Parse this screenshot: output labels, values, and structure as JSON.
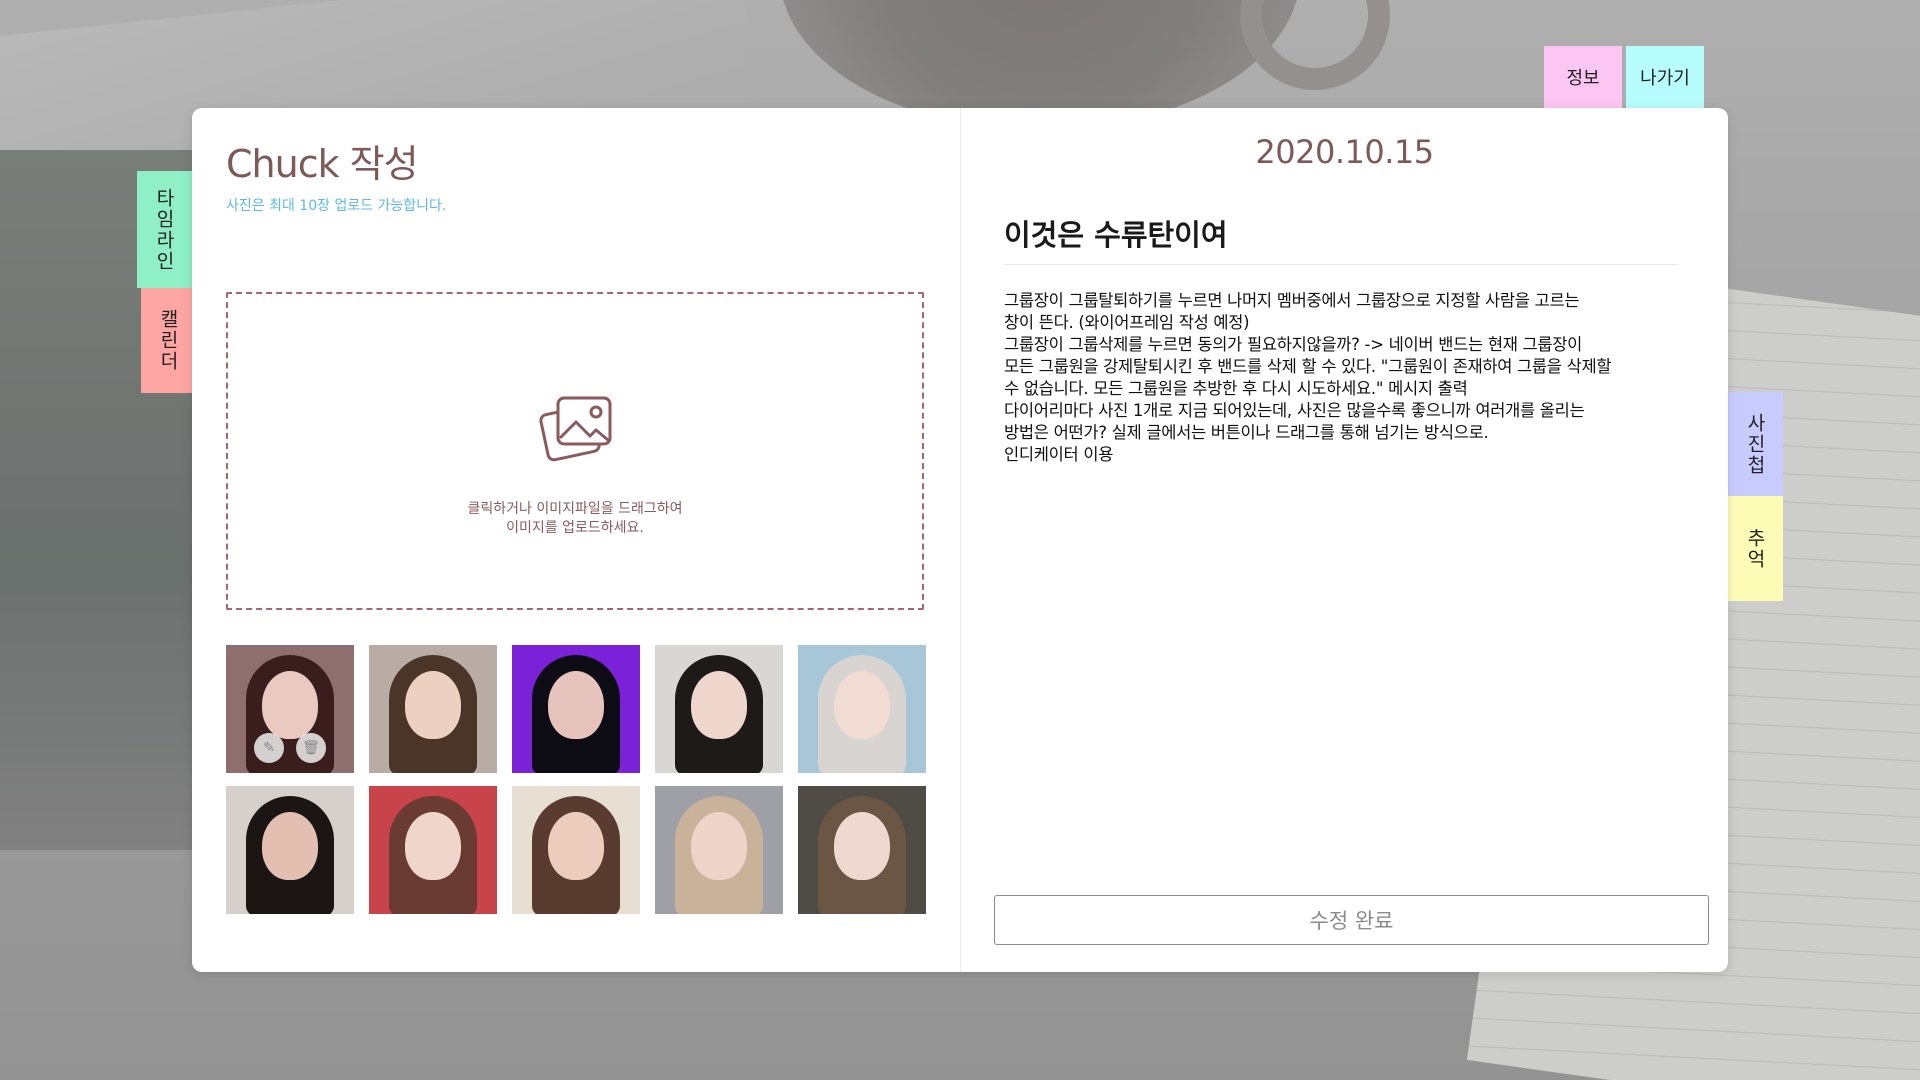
{
  "header": {
    "info_label": "정보",
    "exit_label": "나가기"
  },
  "side_tabs": {
    "timeline": "타임라인",
    "calendar": "캘린더",
    "album": "사진첩",
    "memory": "추억"
  },
  "editor": {
    "title": "Chuck 작성",
    "subtitle": "사진은 최대 10장 업로드 가능합니다.",
    "dropzone": {
      "icon": "image-upload-icon",
      "line1": "클릭하거나 이미지파일을 드래그하여",
      "line2": "이미지를 업로드하세요."
    },
    "photos": [
      {
        "name": "photo-1",
        "bg": "#8e6f6e",
        "hair": "#3a1e1e",
        "face": "#e9c9c0"
      },
      {
        "name": "photo-2",
        "bg": "#b9aca5",
        "hair": "#4a3528",
        "face": "#ecd0c2"
      },
      {
        "name": "photo-3",
        "bg": "#7b22d8",
        "hair": "#0e0c14",
        "face": "#e6c3bc"
      },
      {
        "name": "photo-4",
        "bg": "#d9d7d3",
        "hair": "#1d1a18",
        "face": "#efd6cc"
      },
      {
        "name": "photo-5",
        "bg": "#a7c6d8",
        "hair": "#d8d4d2",
        "face": "#f1dcd3"
      },
      {
        "name": "photo-6",
        "bg": "#d6d0cc",
        "hair": "#1b1514",
        "face": "#e3bfb1"
      },
      {
        "name": "photo-7",
        "bg": "#c9434a",
        "hair": "#6a3b33",
        "face": "#f0d5cb"
      },
      {
        "name": "photo-8",
        "bg": "#e7dfd4",
        "hair": "#5a3b2f",
        "face": "#ecccbc"
      },
      {
        "name": "photo-9",
        "bg": "#9e9fa7",
        "hair": "#c9b29a",
        "face": "#edd3c8"
      },
      {
        "name": "photo-10",
        "bg": "#4f4b45",
        "hair": "#6b5545",
        "face": "#efd8cf"
      }
    ],
    "edit_icon": "✎",
    "delete_icon": "🗑"
  },
  "post": {
    "date": "2020.10.15",
    "title": "이것은 수류탄이여",
    "body": "그룹장이 그룹탈퇴하기를 누르면 나머지 멤버중에서 그룹장으로 지정할 사람을 고르는\n창이 뜬다. (와이어프레임 작성 예정)\n그룹장이 그룹삭제를 누르면 동의가 필요하지않을까? -> 네이버 밴드는 현재 그룹장이\n모든 그룹원을 강제탈퇴시킨 후 밴드를 삭제 할 수 있다. \"그룹원이 존재하여 그룹을 삭제할\n수 없습니다. 모든 그룹원을 추방한 후 다시 시도하세요.\" 메시지 출력\n다이어리마다 사진 1개로 지금 되어있는데, 사진은 많을수록 좋으니까 여러개를 올리는\n 방법은 어떤가? 실제 글에서는 버튼이나 드래그를 통해 넘기는 방식으로.\n인디케이터 이용",
    "done_label": "수정 완료"
  }
}
